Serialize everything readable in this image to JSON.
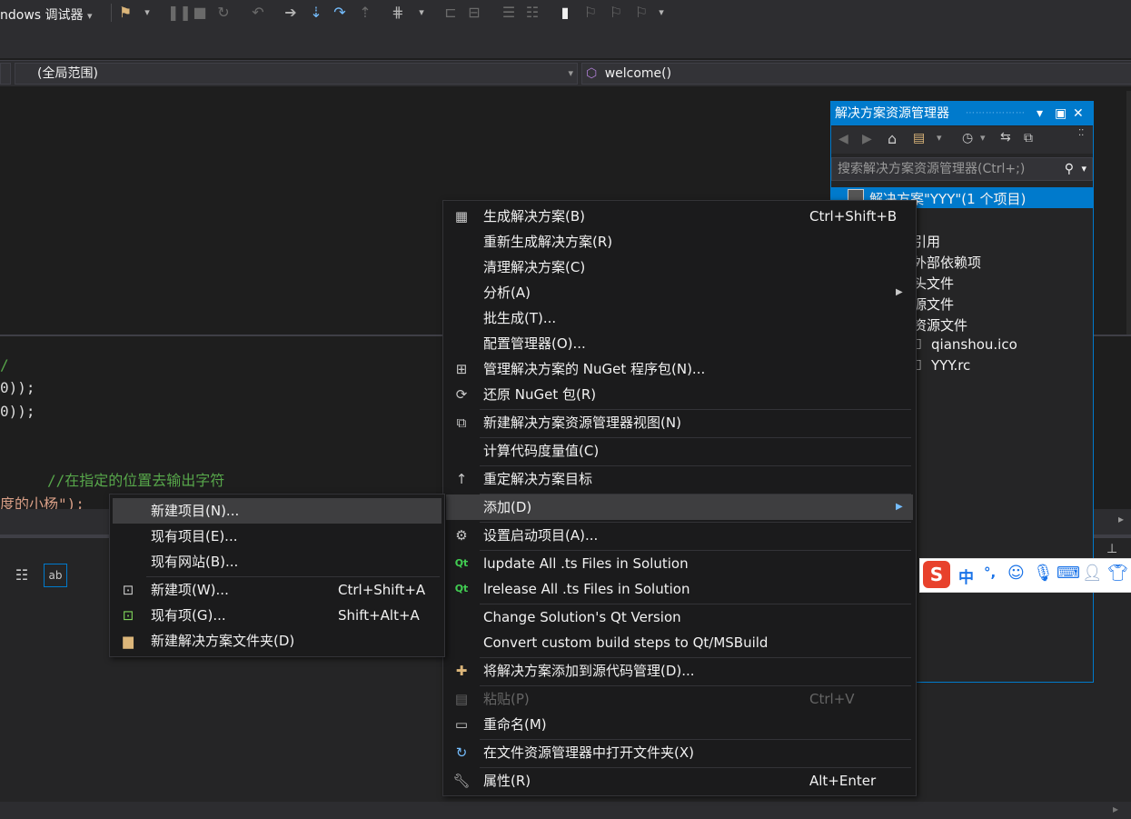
{
  "toolbar": {
    "debugger_label": "ndows 调试器",
    "dropdown_arrow": "▾"
  },
  "navbar": {
    "scope": "(全局范围)",
    "function": "welcome()"
  },
  "editor": {
    "lines": [
      "0));",
      "0));",
      "//在指定的位置去输出字符",
      "度的小杨\");"
    ]
  },
  "solution_explorer": {
    "title": "解决方案资源管理器",
    "search_placeholder": "搜索解决方案资源管理器(Ctrl+;)",
    "items": [
      "解决方案\"YYY\"(1 个项目)",
      "引用",
      "外部依赖项",
      "头文件",
      "源文件",
      "资源文件",
      "qianshou.ico",
      "YYY.rc"
    ]
  },
  "context_menu": {
    "items": [
      {
        "label": "生成解决方案(B)",
        "shortcut": "Ctrl+Shift+B"
      },
      {
        "label": "重新生成解决方案(R)"
      },
      {
        "label": "清理解决方案(C)"
      },
      {
        "label": "分析(A)"
      },
      {
        "label": "批生成(T)..."
      },
      {
        "label": "配置管理器(O)..."
      },
      {
        "label": "管理解决方案的 NuGet 程序包(N)..."
      },
      {
        "label": "还原 NuGet 包(R)"
      },
      {
        "label": "新建解决方案资源管理器视图(N)"
      },
      {
        "label": "计算代码度量值(C)"
      },
      {
        "label": "重定解决方案目标"
      },
      {
        "label": "添加(D)"
      },
      {
        "label": "设置启动项目(A)..."
      },
      {
        "label": "lupdate All .ts Files in Solution"
      },
      {
        "label": "lrelease All .ts Files in Solution"
      },
      {
        "label": "Change Solution's Qt Version"
      },
      {
        "label": "Convert custom build steps to Qt/MSBuild"
      },
      {
        "label": "将解决方案添加到源代码管理(D)..."
      },
      {
        "label": "粘贴(P)",
        "shortcut": "Ctrl+V"
      },
      {
        "label": "重命名(M)"
      },
      {
        "label": "在文件资源管理器中打开文件夹(X)"
      },
      {
        "label": "属性(R)",
        "shortcut": "Alt+Enter"
      }
    ]
  },
  "submenu": {
    "items": [
      {
        "label": "新建项目(N)..."
      },
      {
        "label": "现有项目(E)..."
      },
      {
        "label": "现有网站(B)..."
      },
      {
        "label": "新建项(W)...",
        "shortcut": "Ctrl+Shift+A"
      },
      {
        "label": "现有项(G)...",
        "shortcut": "Shift+Alt+A"
      },
      {
        "label": "新建解决方案文件夹(D)"
      }
    ]
  },
  "ime": {
    "mode": "中",
    "punct": "°,"
  },
  "colors": {
    "accent": "#007acc",
    "background": "#1e1e1e",
    "menu_bg": "#1b1b1c",
    "highlight": "#3e3e40",
    "comment": "#57a64a",
    "string": "#d69d85",
    "ime_red": "#e8412c"
  }
}
